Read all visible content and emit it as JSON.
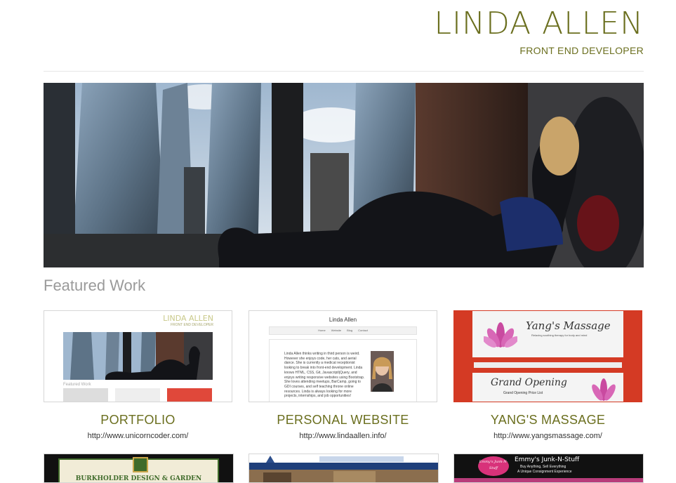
{
  "header": {
    "name": "LINDA ALLEN",
    "subtitle": "FRONT END DEVELOPER"
  },
  "featured": {
    "title": "Featured Work",
    "cards": [
      {
        "title": "PORTFOLIO",
        "url": "http://www.unicorncoder.com/"
      },
      {
        "title": "PERSONAL WEBSITE",
        "url": "http://www.lindaallen.info/"
      },
      {
        "title": "YANG'S MASSAGE",
        "url": "http://www.yangsmassage.com/"
      }
    ]
  },
  "thumbs": {
    "portfolio": {
      "name": "LINDA ALLEN",
      "sub": "FRONT END DEVELOPER",
      "section": "Featured Work"
    },
    "personal": {
      "name": "Linda Allen",
      "nav": [
        "Home",
        "Website",
        "Blog",
        "Contact"
      ],
      "bio": "Linda Allen thinks writing in third person is weird. However she enjoys code, her cats, and aerial dance. She is currently a medical receptionist looking to break into front-end development. Linda knows HTML, CSS, Git, Javascript/jQuery, and enjoys writing responsive websites using Bootstrap. She loves attending meetups, BarCamp, going to GDI courses, and self teaching throne online resources. Linda is always looking for more projects, internships, and job opportunities!"
    },
    "yang": {
      "logo": "Yang's Massage",
      "tag": "Relaxing soothing therapy for body and mind",
      "promo": "Grand Opening",
      "promo_sub": "Grand Opening Price List"
    },
    "burkholder": {
      "title": "BURKHOLDER DESIGN & GARDEN CENTER"
    },
    "emmy": {
      "title": "Emmy's Junk-N-Stuff",
      "tag1": "Buy Anything, Sell Everything",
      "tag2": "A Unique Consignment Experience",
      "logo": "Emmy's Junk-N-Stuff"
    }
  },
  "colors": {
    "accent": "#6b6f1f",
    "muted": "#9a9a9a"
  }
}
